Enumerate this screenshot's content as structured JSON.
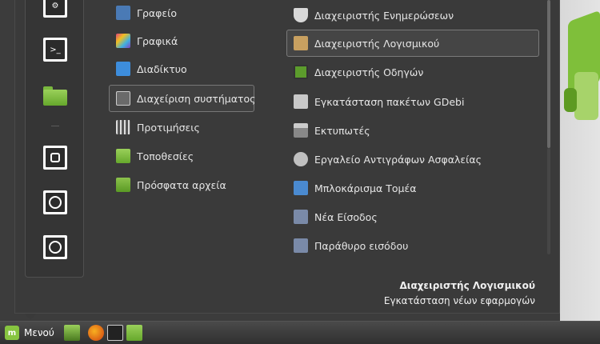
{
  "categories": [
    {
      "label": "Γραφείο",
      "icon": "office-icon",
      "color": "#4a7ab5"
    },
    {
      "label": "Γραφικά",
      "icon": "graphics-icon",
      "color": "#e0427a"
    },
    {
      "label": "Διαδίκτυο",
      "icon": "internet-icon",
      "color": "#3d8ddc"
    },
    {
      "label": "Διαχείριση συστήματος",
      "icon": "system-admin-icon",
      "color": "#6a6a6a"
    },
    {
      "label": "Προτιμήσεις",
      "icon": "preferences-icon",
      "color": "#9a9a9a"
    },
    {
      "label": "Τοποθεσίες",
      "icon": "places-folder-icon",
      "color": "#7ab83e"
    },
    {
      "label": "Πρόσφατα αρχεία",
      "icon": "recent-files-icon",
      "color": "#6aa830"
    }
  ],
  "apps": [
    {
      "label": "Διαχειριστής Ενημερώσεων",
      "icon": "shield-icon",
      "color": "#d8d8d8"
    },
    {
      "label": "Διαχειριστής Λογισμικού",
      "icon": "software-manager-icon",
      "color": "#c8a060"
    },
    {
      "label": "Διαχειριστής Οδηγών",
      "icon": "driver-manager-icon",
      "color": "#5c9c2c"
    },
    {
      "label": "Εγκατάσταση πακέτων GDebi",
      "icon": "gdebi-icon",
      "color": "#c8c8c8"
    },
    {
      "label": "Εκτυπωτές",
      "icon": "printer-icon",
      "color": "#888888"
    },
    {
      "label": "Εργαλείο Αντιγράφων Ασφαλείας",
      "icon": "backup-icon",
      "color": "#c0c0c0"
    },
    {
      "label": "Μπλοκάρισμα Τομέα",
      "icon": "domain-block-icon",
      "color": "#4a8ad0"
    },
    {
      "label": "Νέα Είσοδος",
      "icon": "new-login-icon",
      "color": "#7a8aa8"
    },
    {
      "label": "Παράθυρο εισόδου",
      "icon": "login-window-icon",
      "color": "#7a8aa8"
    }
  ],
  "description": {
    "title": "Διαχειριστής Λογισμικού",
    "text": "Εγκατάσταση νέων εφαρμογών"
  },
  "taskbar": {
    "menu_label": "Μενού"
  },
  "colors": {
    "accent": "#87c540",
    "panel": "#3a3a3a"
  }
}
